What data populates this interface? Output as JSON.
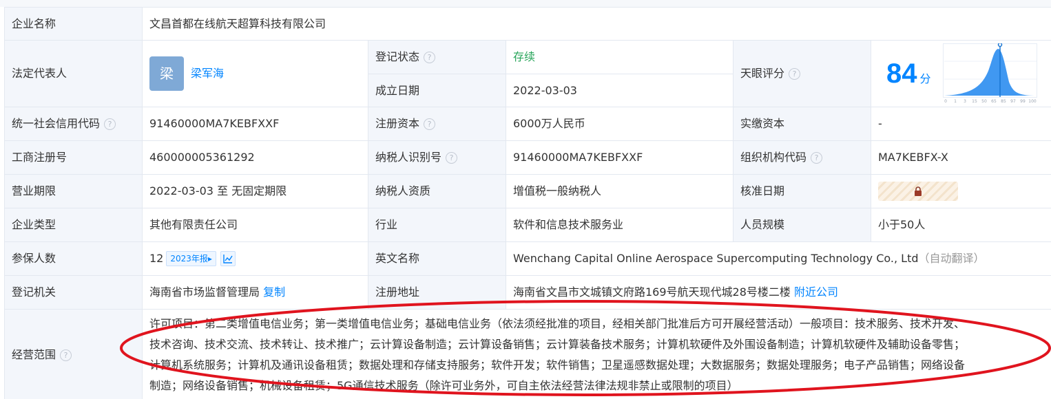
{
  "company": {
    "label": "企业名称",
    "value": "文昌首都在线航天超算科技有限公司"
  },
  "legal_rep": {
    "label": "法定代表人",
    "avatar_char": "梁",
    "name": "梁军海"
  },
  "reg_status": {
    "label": "登记状态",
    "value": "存续"
  },
  "found_date": {
    "label": "成立日期",
    "value": "2022-03-03"
  },
  "tianyan_score": {
    "label": "天眼评分",
    "score": "84",
    "unit": "分",
    "axis_ticks": [
      "0",
      "1",
      "3",
      "15",
      "50",
      "65",
      "85",
      "97",
      "99",
      "100"
    ]
  },
  "credit_code": {
    "label": "统一社会信用代码",
    "value": "91460000MA7KEBFXXF"
  },
  "reg_capital": {
    "label": "注册资本",
    "value": "6000万人民币"
  },
  "paid_capital": {
    "label": "实缴资本",
    "value": "-"
  },
  "biz_reg_no": {
    "label": "工商注册号",
    "value": "460000005361292"
  },
  "taxpayer_id": {
    "label": "纳税人识别号",
    "value": "91460000MA7KEBFXXF"
  },
  "org_code": {
    "label": "组织机构代码",
    "value": "MA7KEBFX-X"
  },
  "biz_term": {
    "label": "营业期限",
    "value": "2022-03-03 至 无固定期限"
  },
  "taxpayer_qual": {
    "label": "纳税人资质",
    "value": "增值税一般纳税人"
  },
  "approval_date": {
    "label": "核准日期"
  },
  "company_type": {
    "label": "企业类型",
    "value": "其他有限责任公司"
  },
  "industry": {
    "label": "行业",
    "value": "软件和信息技术服务业"
  },
  "staff_size": {
    "label": "人员规模",
    "value": "小于50人"
  },
  "insured": {
    "label": "参保人数",
    "value": "12",
    "report_badge": "2023年报▸"
  },
  "english_name": {
    "label": "英文名称",
    "value": "Wenchang Capital Online Aerospace Supercomputing Technology Co., Ltd",
    "note": "（自动翻译）"
  },
  "reg_authority": {
    "label": "登记机关",
    "value": "海南省市场监督管理局",
    "copy": "复制"
  },
  "reg_address": {
    "label": "注册地址",
    "value": "海南省文昌市文城镇文府路169号航天现代城28号楼二楼",
    "nearby": "附近公司"
  },
  "biz_scope": {
    "label": "经营范围",
    "lines": [
      "许可项目：第二类增值电信业务；第一类增值电信业务；基础电信业务（依法须经批准的项目，经相关部门批准后方可开展经营活动）一般项目：技术服务、技术开发、",
      "技术咨询、技术交流、技术转让、技术推广；云计算设备制造；云计算设备销售；云计算装备技术服务；计算机软硬件及外围设备制造；计算机软硬件及辅助设备零售；",
      "计算机系统服务；计算机及通讯设备租赁；数据处理和存储支持服务；软件开发；软件销售；卫星遥感数据处理；大数据服务；数据处理服务；电子产品销售；网络设备",
      "制造；网络设备销售；机械设备租赁；5G通信技术服务（除许可业务外，可自主依法经营法律法规非禁止或限制的项目）"
    ]
  },
  "colors": {
    "accent": "#0084ff",
    "status_green": "#27a55a",
    "label_bg": "#f3f6fb",
    "annotation_red": "#e0141e"
  }
}
